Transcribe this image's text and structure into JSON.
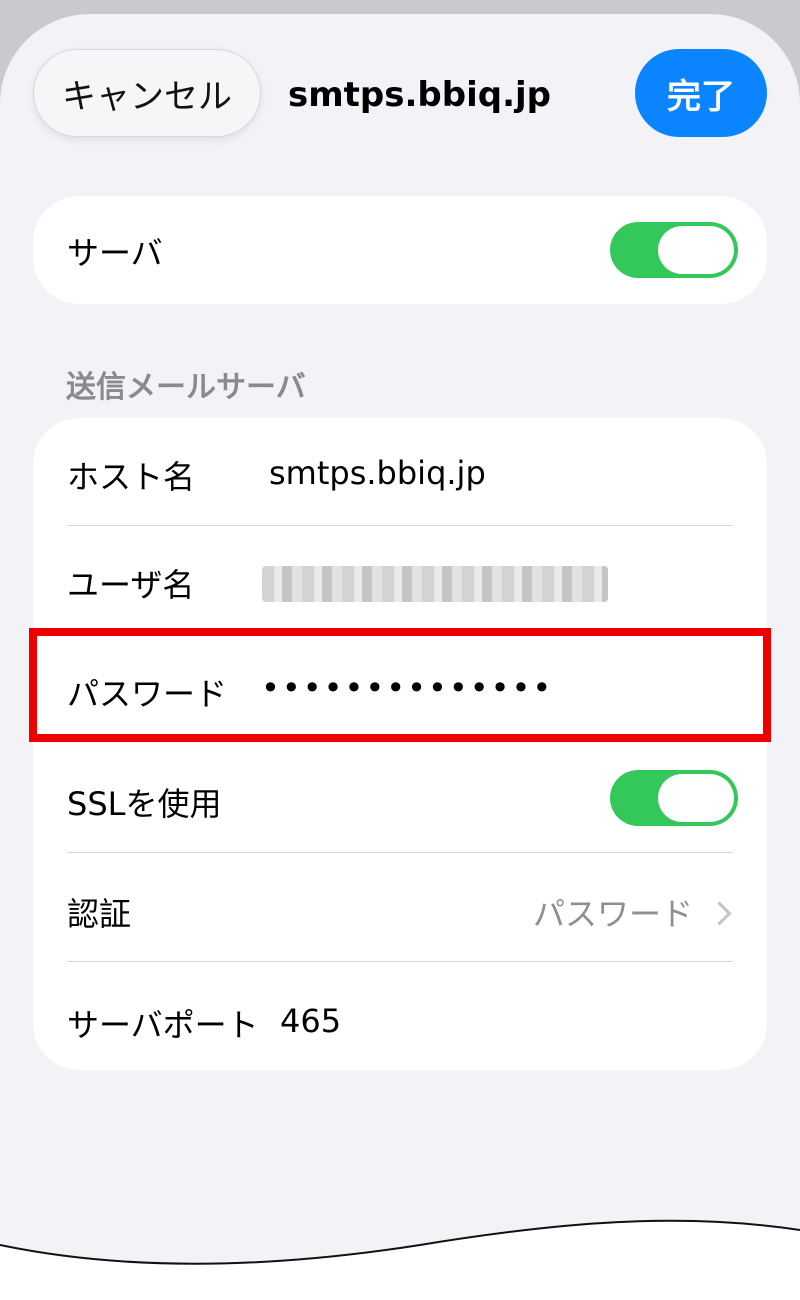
{
  "nav": {
    "cancel_label": "キャンセル",
    "title": "smtps.bbiq.jp",
    "done_label": "完了"
  },
  "server_toggle": {
    "label": "サーバ",
    "on": true
  },
  "outgoing": {
    "section_title": "送信メールサーバ",
    "host_label": "ホスト名",
    "host_value": "smtps.bbiq.jp",
    "user_label": "ユーザ名",
    "password_label": "パスワード",
    "password_value": "••••••••••••••",
    "ssl_label": "SSLを使用",
    "ssl_on": true,
    "auth_label": "認証",
    "auth_value": "パスワード",
    "port_label": "サーバポート",
    "port_value": "465"
  },
  "colors": {
    "accent": "#0a84ff",
    "toggle_on": "#34c759",
    "highlight": "#ee0000"
  }
}
